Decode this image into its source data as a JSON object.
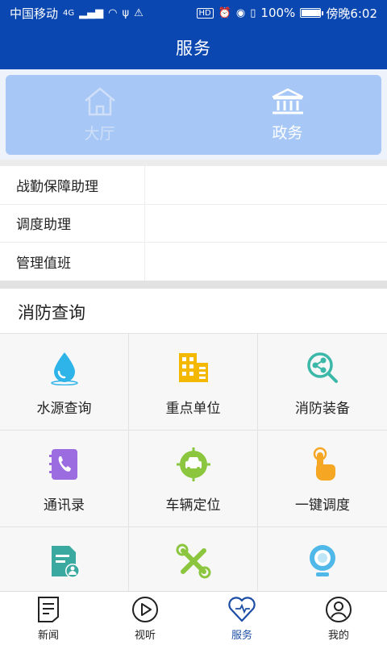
{
  "status_bar": {
    "carrier": "中国移动",
    "network": "4G",
    "battery": "100%",
    "time": "傍晚6:02",
    "hd_label": "HD"
  },
  "header": {
    "title": "服务"
  },
  "switcher": {
    "items": [
      {
        "label": "大厅",
        "icon": "house-icon",
        "active": false
      },
      {
        "label": "政务",
        "icon": "government-building-icon",
        "active": true
      }
    ]
  },
  "assistants": [
    {
      "label": "战勤保障助理"
    },
    {
      "label": "调度助理"
    },
    {
      "label": "管理值班"
    }
  ],
  "fire_query": {
    "title": "消防查询",
    "items": [
      {
        "label": "水源查询",
        "icon": "water-drop-icon",
        "color": "#2fb4e9"
      },
      {
        "label": "重点单位",
        "icon": "building-icon",
        "color": "#f5b800"
      },
      {
        "label": "消防装备",
        "icon": "search-molecule-icon",
        "color": "#3bb8a8"
      },
      {
        "label": "通讯录",
        "icon": "phone-book-icon",
        "color": "#9b6be0"
      },
      {
        "label": "车辆定位",
        "icon": "vehicle-location-icon",
        "color": "#8cc63f"
      },
      {
        "label": "一键调度",
        "icon": "tap-hand-icon",
        "color": "#f5a623"
      },
      {
        "label": "",
        "icon": "document-user-icon",
        "color": "#3aa99f"
      },
      {
        "label": "",
        "icon": "tools-icon",
        "color": "#8cc63f"
      },
      {
        "label": "",
        "icon": "webcam-icon",
        "color": "#4fb8e8"
      }
    ]
  },
  "bottom_nav": {
    "items": [
      {
        "label": "新闻",
        "icon": "news-icon",
        "active": false
      },
      {
        "label": "视听",
        "icon": "play-icon",
        "active": false
      },
      {
        "label": "服务",
        "icon": "heart-icon",
        "active": true
      },
      {
        "label": "我的",
        "icon": "user-icon",
        "active": false
      }
    ]
  }
}
